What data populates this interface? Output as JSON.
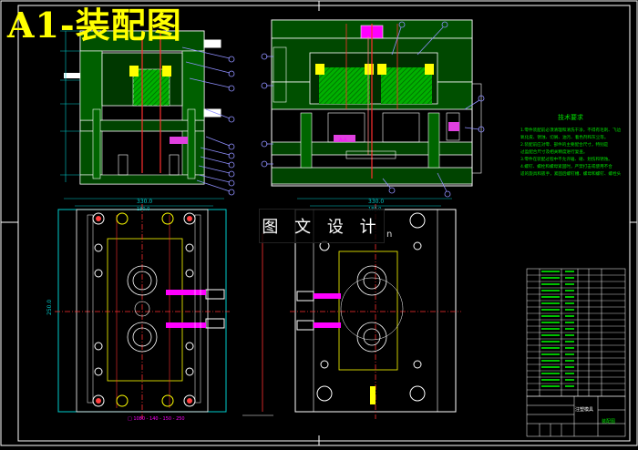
{
  "drawing": {
    "title": "A1-装配图",
    "watermark": "图 文 设 计",
    "watermark_tail": "n",
    "tech_requirements_title": "技术要求",
    "tech_requirements": [
      "1.零件装配前必须清理和清洗干净，不得有毛刺、飞边、",
      "氧化皮、锈蚀、切屑、油污、着色剂和灰尘等。",
      "2.装配前应对零、部件的主要配合尺寸，特别是",
      "过盈配合尺寸及相关精度进行复查。",
      "3.零件在装配过程中不允许磕、碰、划伤和锈蚀。",
      "4.螺钉、螺栓和螺母紧固时，严禁打击或使用不合",
      "适的旋具和扳手，紧固后螺钉槽、螺母和螺钉、螺栓头部不得损坏。"
    ],
    "dim_top_left": "330.0",
    "dim_top_left_inner": "180.0",
    "dim_top_right": "330.0",
    "dim_top_right_inner": "180.0",
    "dim_side_left": "250.0",
    "section_label": "A-A",
    "bottom_caption": "□ 1080 - 140 - 150 - 250",
    "title_block_name": "注塑模具",
    "title_block_sub": "装配图",
    "colors": {
      "background": "#000000",
      "outline": "#ffffff",
      "hatch": "#00c000",
      "dimension": "#00cccc",
      "centerline": "#ff3030",
      "part_fill": "#ffff00",
      "balloon": "#9090ff",
      "title": "#ffff00"
    }
  }
}
